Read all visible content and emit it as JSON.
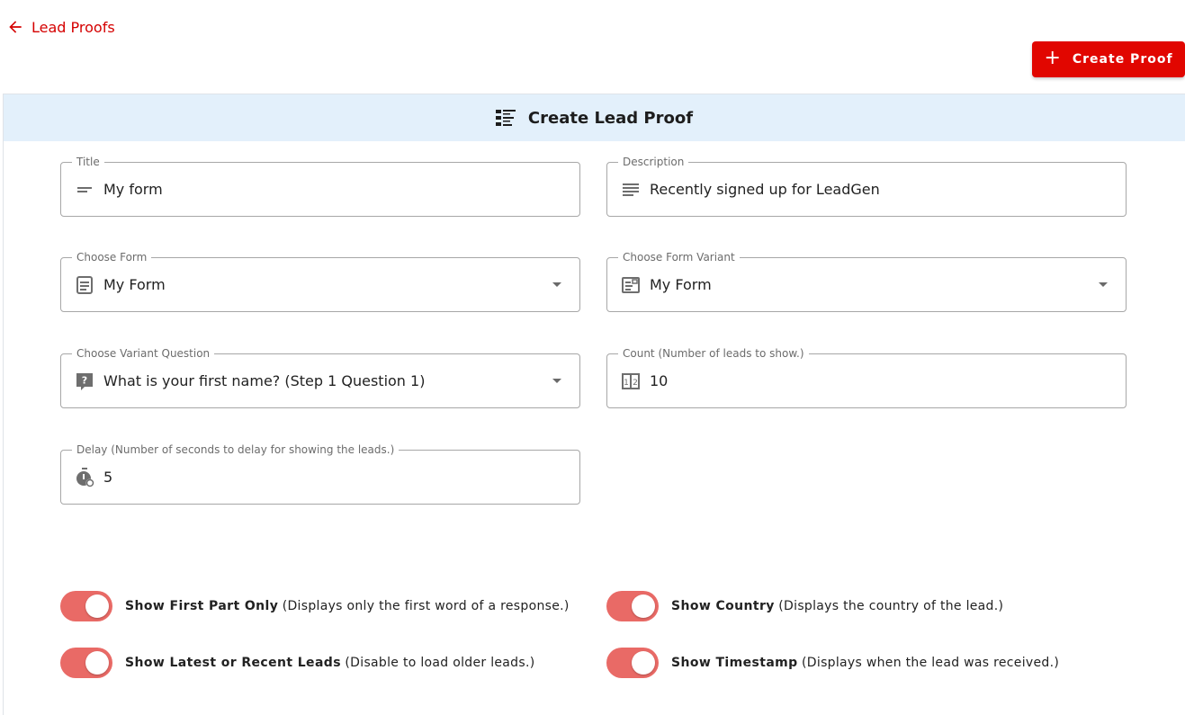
{
  "nav": {
    "back_label": "Lead Proofs"
  },
  "toolbar": {
    "create_label": "Create Proof"
  },
  "card": {
    "title": "Create Lead Proof"
  },
  "fields": {
    "title": {
      "label": "Title",
      "value": "My form",
      "icon": "short-text-icon"
    },
    "description": {
      "label": "Description",
      "value": "Recently signed up for LeadGen",
      "icon": "notes-icon"
    },
    "form": {
      "label": "Choose Form",
      "value": "My Form",
      "icon": "form-icon"
    },
    "variant": {
      "label": "Choose Form Variant",
      "value": "My Form",
      "icon": "form-variant-icon"
    },
    "question": {
      "label": "Choose Variant Question",
      "value": "What is your first name? (Step 1 Question 1)",
      "icon": "question-icon"
    },
    "count": {
      "label": "Count (Number of leads to show.)",
      "value": "10",
      "icon": "numbers-icon"
    },
    "delay": {
      "label": "Delay (Number of seconds to delay for showing the leads.)",
      "value": "5",
      "icon": "timer-icon"
    }
  },
  "toggles": {
    "first_part": {
      "title": "Show First Part Only",
      "desc": "(Displays only the first word of a response.)",
      "on": true
    },
    "country": {
      "title": "Show Country",
      "desc": "(Displays the country of the lead.)",
      "on": true
    },
    "latest": {
      "title": "Show Latest or Recent Leads",
      "desc": "(Disable to load older leads.)",
      "on": true
    },
    "timestamp": {
      "title": "Show Timestamp",
      "desc": "(Displays when the lead was received.)",
      "on": true
    }
  },
  "colors": {
    "accent": "#e10600",
    "link": "#d50000",
    "switch": "#e96a66",
    "header_bg": "#e3f0fb"
  }
}
